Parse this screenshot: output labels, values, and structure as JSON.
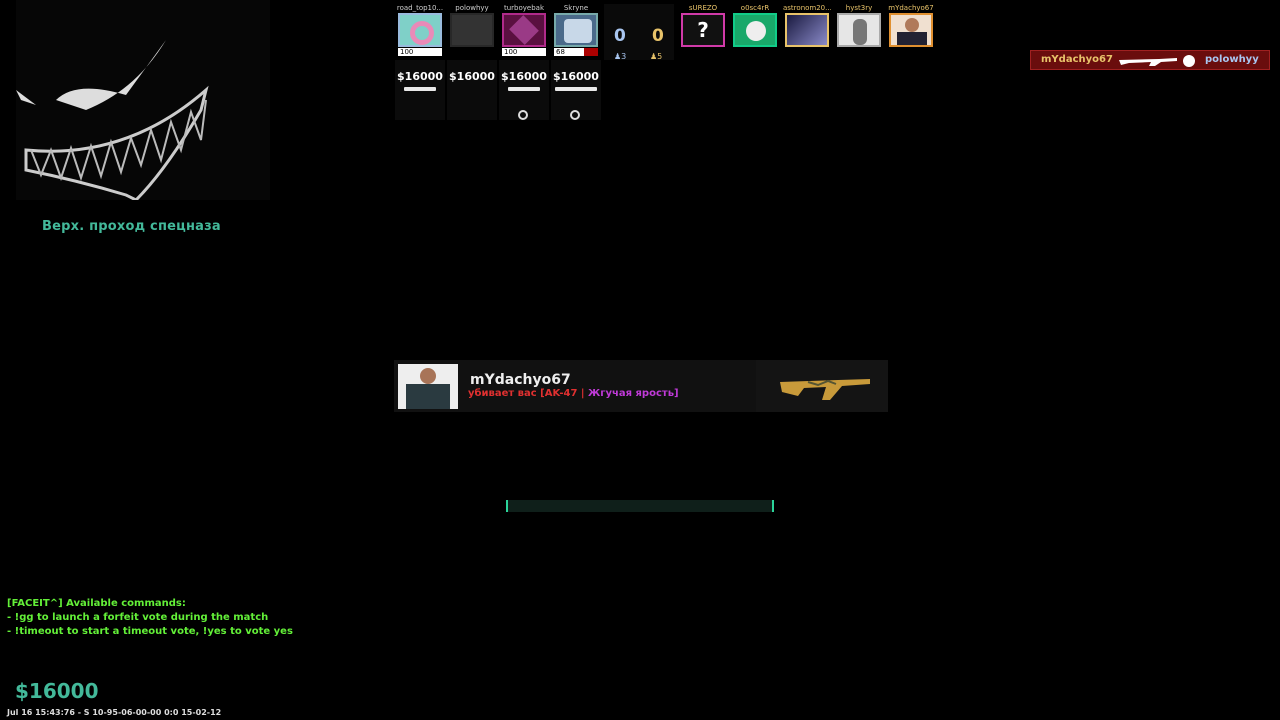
{
  "radar": {
    "location": "Верх. проход спецназа"
  },
  "team_ct": [
    {
      "name": "road_top10...",
      "hp": "100",
      "money": "$16000"
    },
    {
      "name": "polowhyy",
      "hp": "",
      "money": "$16000"
    },
    {
      "name": "turboyebak",
      "hp": "100",
      "money": "$16000"
    },
    {
      "name": "Skryne",
      "hp": "68",
      "money": "$16000"
    }
  ],
  "scoreboard": {
    "score_ct": "0",
    "score_t": "0",
    "alive_ct": "3",
    "alive_t": "5"
  },
  "team_t": [
    {
      "name": "sUREZO",
      "avatar_text": "?"
    },
    {
      "name": "o0sc4rR",
      "avatar_text": ""
    },
    {
      "name": "astronom20...",
      "avatar_text": ""
    },
    {
      "name": "hyst3ry",
      "avatar_text": ""
    },
    {
      "name": "mYdachyo67",
      "avatar_text": ""
    }
  ],
  "killfeed": {
    "killer": "mYdachyo67",
    "victim": "polowhyy"
  },
  "death_notice": {
    "killer": "mYdachyo67",
    "kills_you": "убивает вас",
    "weapon": "[AK-47 |",
    "skin": "Жгучая ярость]"
  },
  "chat": {
    "line1": "[FACEIT^] Available commands:",
    "line2": "- !gg to launch a forfeit vote during the match",
    "line3": "- !timeout to start a timeout vote, !yes to vote yes"
  },
  "player": {
    "money": "$16000"
  },
  "footer": "Jul 16 15:43:76 - S 10-95-06-00-00 0:0 15-02-12",
  "colors": {
    "accent": "#43b99a",
    "chat": "#63f038",
    "ct_score": "#a9c6f0",
    "t_score": "#e8c36a"
  }
}
